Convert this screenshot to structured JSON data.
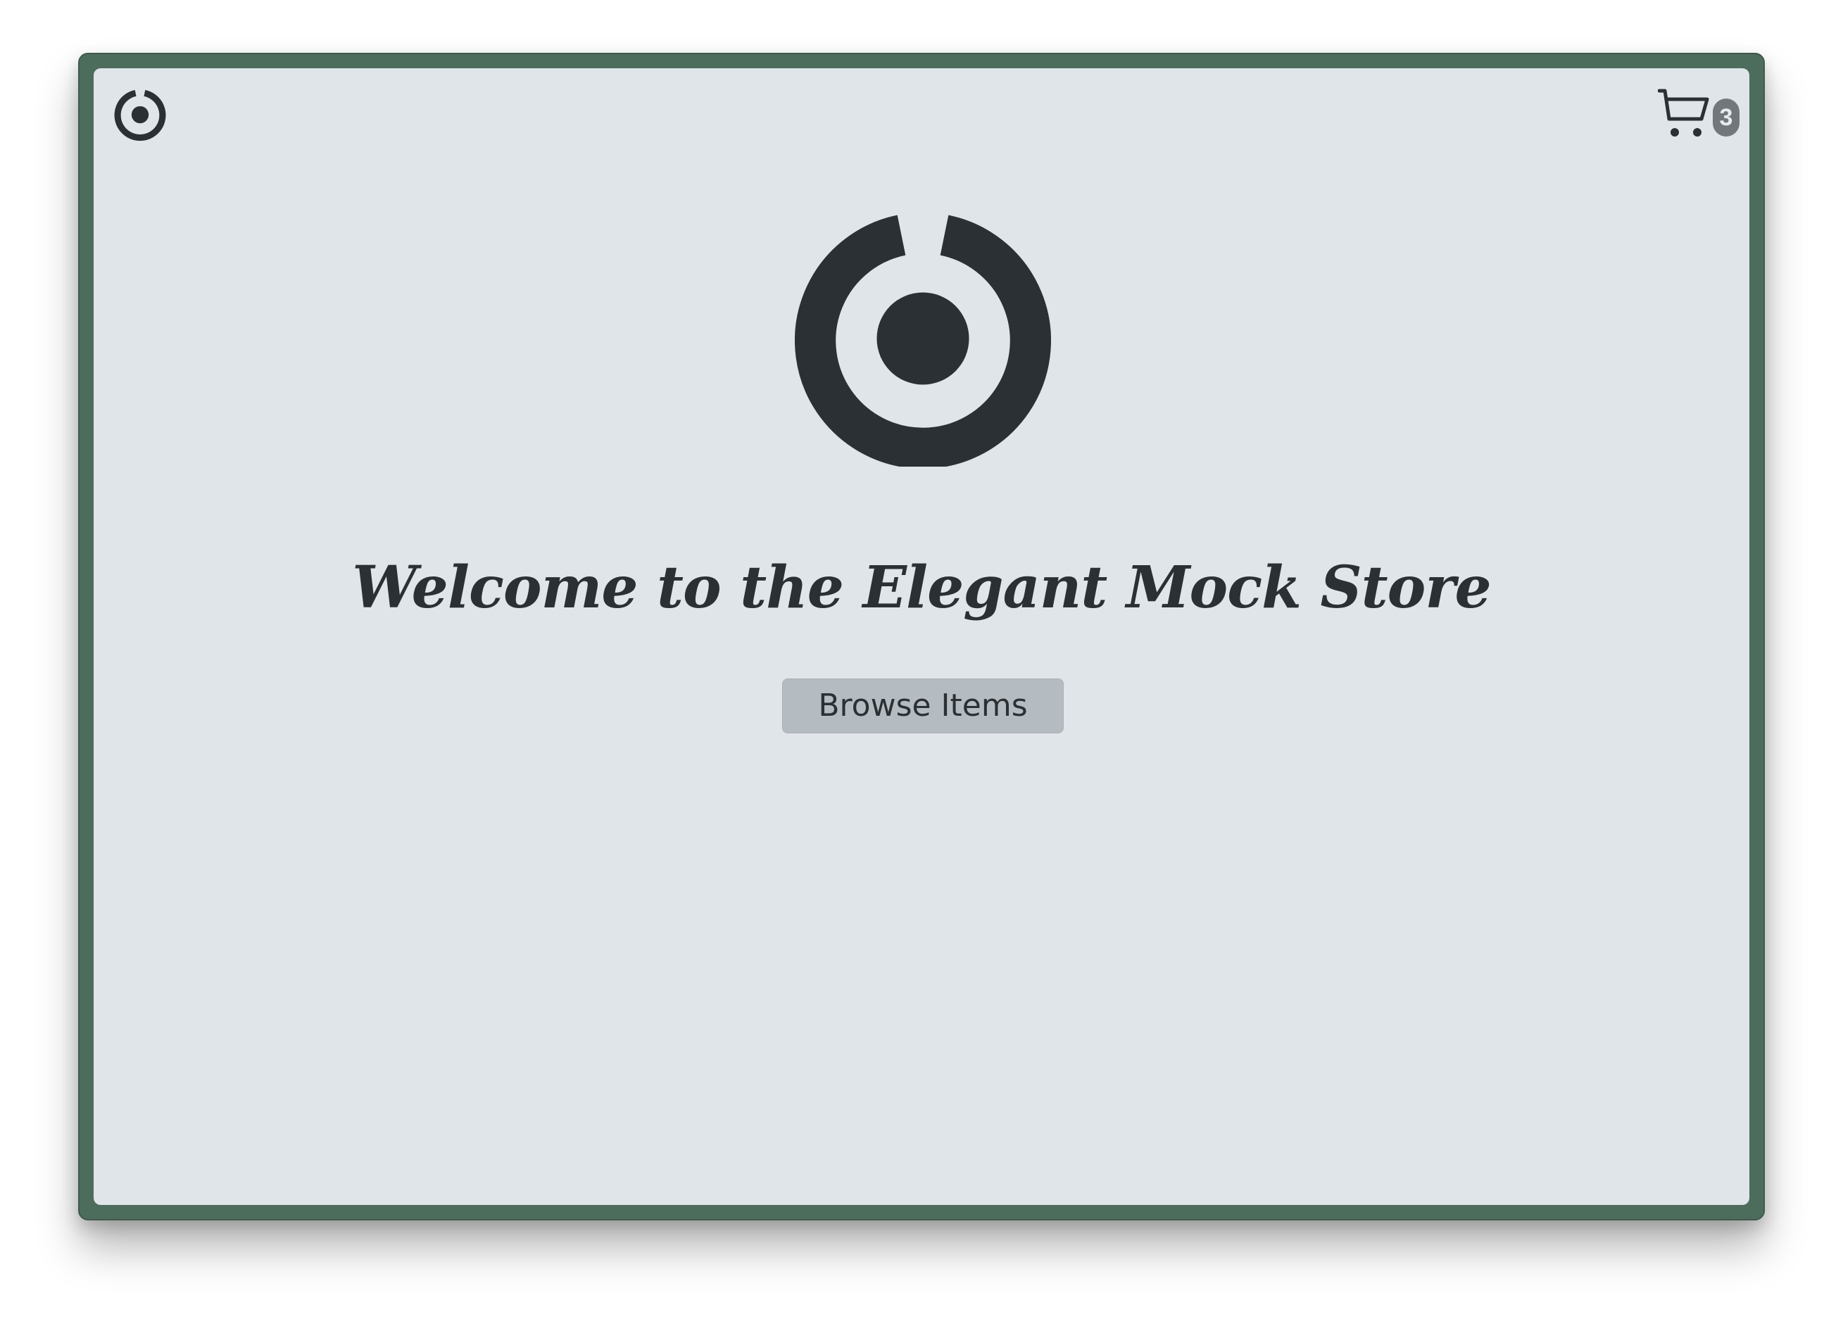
{
  "header": {
    "logo_icon": "store-logo-icon",
    "cart_icon": "shopping-cart-icon",
    "cart_count": "3"
  },
  "hero": {
    "logo_icon": "store-logo-icon",
    "headline": "Welcome to the Elegant Mock Store",
    "button_label": "Browse Items"
  },
  "colors": {
    "frame": "#4d6d5c",
    "background": "#e0e5e9",
    "foreground": "#2b3034",
    "button": "#b5bcc1",
    "badge": "#72777c"
  }
}
